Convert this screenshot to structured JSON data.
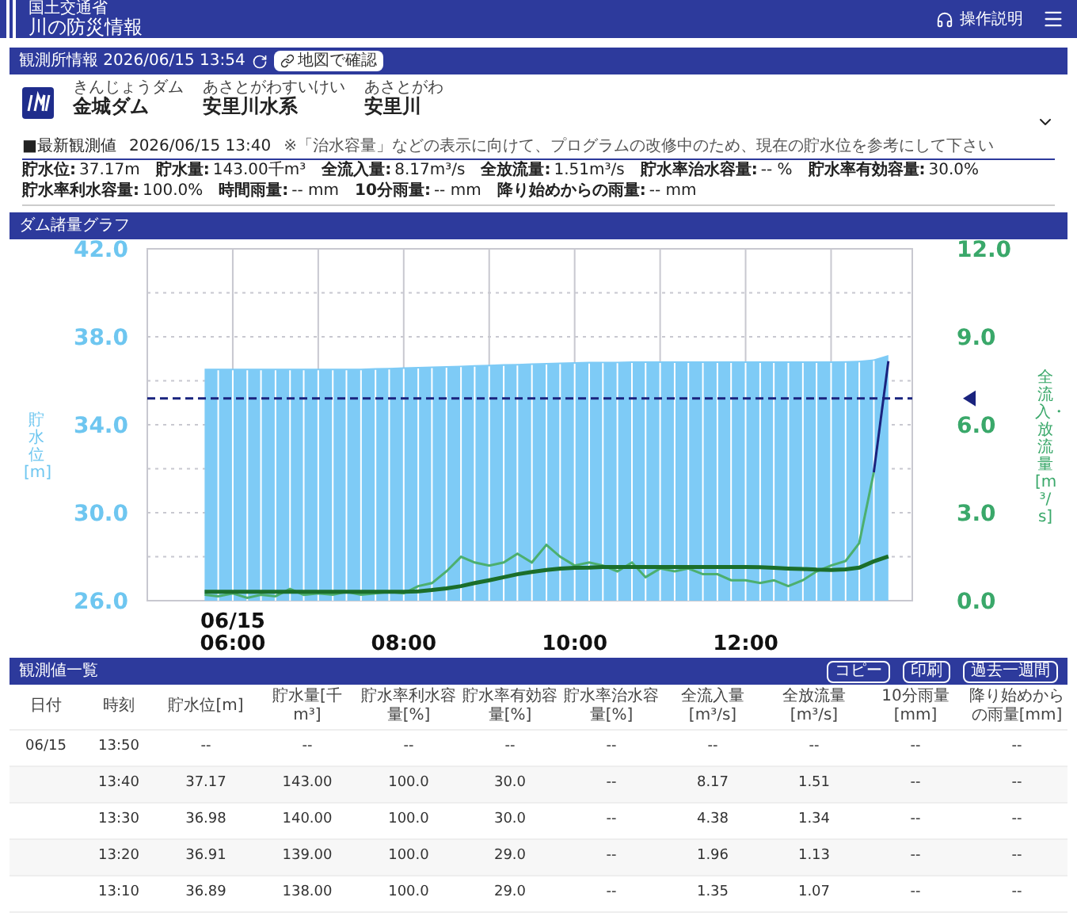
{
  "header": {
    "ministry": "国土交通省",
    "title": "川の防災情報",
    "help": "操作説明"
  },
  "station_bar": {
    "title": "観測所情報 2026/06/15 13:54",
    "map_button": "地図で確認"
  },
  "station": {
    "names": [
      {
        "ruby": "きんじょうダム",
        "name": "金城ダム"
      },
      {
        "ruby": "あさとがわすいけい",
        "name": "安里川水系"
      },
      {
        "ruby": "あさとがわ",
        "name": "安里川"
      }
    ],
    "expanded": false
  },
  "latest": {
    "label": "■最新観測値",
    "time": "2026/06/15 13:40",
    "note": "※「治水容量」などの表示に向けて、プログラムの改修中のため、現在の貯水位を参考にして下さい"
  },
  "measurements": [
    {
      "label": "貯水位:",
      "value": "37.17m"
    },
    {
      "label": "貯水量:",
      "value": "143.00千m³"
    },
    {
      "label": "全流入量:",
      "value": "8.17m³/s"
    },
    {
      "label": "全放流量:",
      "value": "1.51m³/s"
    },
    {
      "label": "貯水率治水容量:",
      "value": "-- %"
    },
    {
      "label": "貯水率有効容量:",
      "value": "30.0%"
    },
    {
      "label": "貯水率利水容量:",
      "value": "100.0%"
    },
    {
      "label": "時間雨量:",
      "value": "-- mm"
    },
    {
      "label": "10分雨量:",
      "value": "-- mm"
    },
    {
      "label": "降り始めからの雨量:",
      "value": "-- mm"
    }
  ],
  "chart": {
    "title": "ダム諸量グラフ",
    "level": {
      "chart_data": {
        "type": "area",
        "ylabel": "貯水位[m]",
        "xlim": [
          5,
          13.95
        ],
        "ylim": [
          26,
          42
        ],
        "yticks": [
          {
            "value": 26,
            "label": "26.0"
          },
          {
            "value": 30,
            "label": "30.0"
          },
          {
            "value": 34,
            "label": "34.0"
          },
          {
            "value": 38,
            "label": "38.0"
          },
          {
            "value": 42,
            "label": "42.0"
          }
        ],
        "xticks": [
          {
            "value": 6,
            "label": "06/15 06:00"
          },
          {
            "value": 8,
            "label": "08:00"
          },
          {
            "value": 10,
            "label": "10:00"
          },
          {
            "value": 12,
            "label": "12:00"
          }
        ],
        "x": [
          5.67,
          5.83,
          6,
          6.17,
          6.33,
          6.5,
          6.67,
          6.83,
          7,
          7.17,
          7.33,
          7.5,
          7.67,
          7.83,
          8,
          8.17,
          8.33,
          8.5,
          8.67,
          8.83,
          9,
          9.17,
          9.33,
          9.5,
          9.67,
          9.83,
          10,
          10.17,
          10.33,
          10.5,
          10.67,
          10.83,
          11,
          11.17,
          11.33,
          11.5,
          11.67,
          11.83,
          12,
          12.17,
          12.33,
          12.5,
          12.67,
          12.83,
          13,
          13.17,
          13.33,
          13.5,
          13.67
        ],
        "series": [
          {
            "color": "#7ecbf6",
            "values": [
              36.55,
              36.55,
              36.55,
              36.55,
              36.55,
              36.55,
              36.55,
              36.55,
              36.55,
              36.55,
              36.55,
              36.55,
              36.57,
              36.59,
              36.61,
              36.63,
              36.65,
              36.67,
              36.69,
              36.71,
              36.73,
              36.75,
              36.77,
              36.79,
              36.81,
              36.83,
              36.85,
              36.86,
              36.87,
              36.87,
              36.88,
              36.88,
              36.88,
              36.88,
              36.88,
              36.88,
              36.88,
              36.88,
              36.88,
              36.88,
              36.88,
              36.88,
              36.88,
              36.88,
              36.88,
              36.89,
              36.91,
              36.98,
              37.17
            ]
          }
        ],
        "grid": true
      },
      "limit_line": true
    },
    "flow": {
      "chart_data": {
        "type": "line",
        "ylabel": "全流入・放流量[m³/s]",
        "xlim": [
          5,
          13.95
        ],
        "ylim": [
          0,
          12
        ],
        "yticks": [
          {
            "value": 0,
            "label": "0.0"
          },
          {
            "value": 3,
            "label": "3.0"
          },
          {
            "value": 6,
            "label": "6.0"
          },
          {
            "value": 9,
            "label": "9.0"
          },
          {
            "value": 12,
            "label": "12.0"
          }
        ],
        "x": [
          5.67,
          5.83,
          6,
          6.17,
          6.33,
          6.5,
          6.67,
          6.83,
          7,
          7.17,
          7.33,
          7.5,
          7.67,
          7.83,
          8,
          8.17,
          8.33,
          8.5,
          8.67,
          8.83,
          9,
          9.17,
          9.33,
          9.5,
          9.67,
          9.83,
          10,
          10.17,
          10.33,
          10.5,
          10.67,
          10.83,
          11,
          11.17,
          11.33,
          11.5,
          11.67,
          11.83,
          12,
          12.17,
          12.33,
          12.5,
          12.67,
          12.83,
          13,
          13.17,
          13.33,
          13.5,
          13.67
        ],
        "series": [
          {
            "color": "#4caf6e",
            "values": [
              0.2,
              0.15,
              0.25,
              0.1,
              0.2,
              0.15,
              0.4,
              0.2,
              0.25,
              0.2,
              0.3,
              0.2,
              0.25,
              0.3,
              0.25,
              0.5,
              0.6,
              1.0,
              1.5,
              1.3,
              1.2,
              1.3,
              1.6,
              1.3,
              1.9,
              1.5,
              1.2,
              1.3,
              1.2,
              1.0,
              1.3,
              0.8,
              1.1,
              1.0,
              1.1,
              0.9,
              0.9,
              0.7,
              0.7,
              0.6,
              0.7,
              0.5,
              0.7,
              1.0,
              1.2,
              1.35,
              1.96,
              4.38,
              null
            ]
          },
          {
            "color": "#1a237e",
            "values": [
              null,
              null,
              null,
              null,
              null,
              null,
              null,
              null,
              null,
              null,
              null,
              null,
              null,
              null,
              null,
              null,
              null,
              null,
              null,
              null,
              null,
              null,
              null,
              null,
              null,
              null,
              null,
              null,
              null,
              null,
              null,
              null,
              null,
              null,
              null,
              null,
              null,
              null,
              null,
              null,
              null,
              null,
              null,
              null,
              null,
              null,
              null,
              4.38,
              8.17
            ]
          },
          {
            "color": "#1b6e2a",
            "values": [
              0.3,
              0.3,
              0.3,
              0.3,
              0.3,
              0.3,
              0.3,
              0.3,
              0.3,
              0.3,
              0.3,
              0.3,
              0.3,
              0.3,
              0.3,
              0.32,
              0.36,
              0.42,
              0.5,
              0.6,
              0.7,
              0.8,
              0.9,
              0.98,
              1.05,
              1.1,
              1.12,
              1.13,
              1.15,
              1.15,
              1.15,
              1.15,
              1.15,
              1.15,
              1.15,
              1.15,
              1.15,
              1.15,
              1.15,
              1.14,
              1.12,
              1.1,
              1.08,
              1.06,
              1.05,
              1.07,
              1.13,
              1.34,
              1.51
            ]
          }
        ]
      }
    }
  },
  "table": {
    "title": "観測値一覧",
    "buttons": [
      "コピー",
      "印刷",
      "過去一週間"
    ],
    "columns": [
      "日付",
      "時刻",
      "貯水位[m]",
      "貯水量[千m³]",
      "貯水率利水容量[%]",
      "貯水率有効容量[%]",
      "貯水率治水容量[%]",
      "全流入量[m³/s]",
      "全放流量[m³/s]",
      "10分雨量[mm]",
      "降り始めからの雨量[mm]"
    ],
    "rows": [
      [
        "06/15",
        "13:50",
        "--",
        "--",
        "--",
        "--",
        "--",
        "--",
        "--",
        "--",
        "--"
      ],
      [
        "",
        "13:40",
        "37.17",
        "143.00",
        "100.0",
        "30.0",
        "--",
        "8.17",
        "1.51",
        "--",
        "--"
      ],
      [
        "",
        "13:30",
        "36.98",
        "140.00",
        "100.0",
        "30.0",
        "--",
        "4.38",
        "1.34",
        "--",
        "--"
      ],
      [
        "",
        "13:20",
        "36.91",
        "139.00",
        "100.0",
        "29.0",
        "--",
        "1.96",
        "1.13",
        "--",
        "--"
      ],
      [
        "",
        "13:10",
        "36.89",
        "138.00",
        "100.0",
        "29.0",
        "--",
        "1.35",
        "1.07",
        "--",
        "--"
      ]
    ]
  }
}
